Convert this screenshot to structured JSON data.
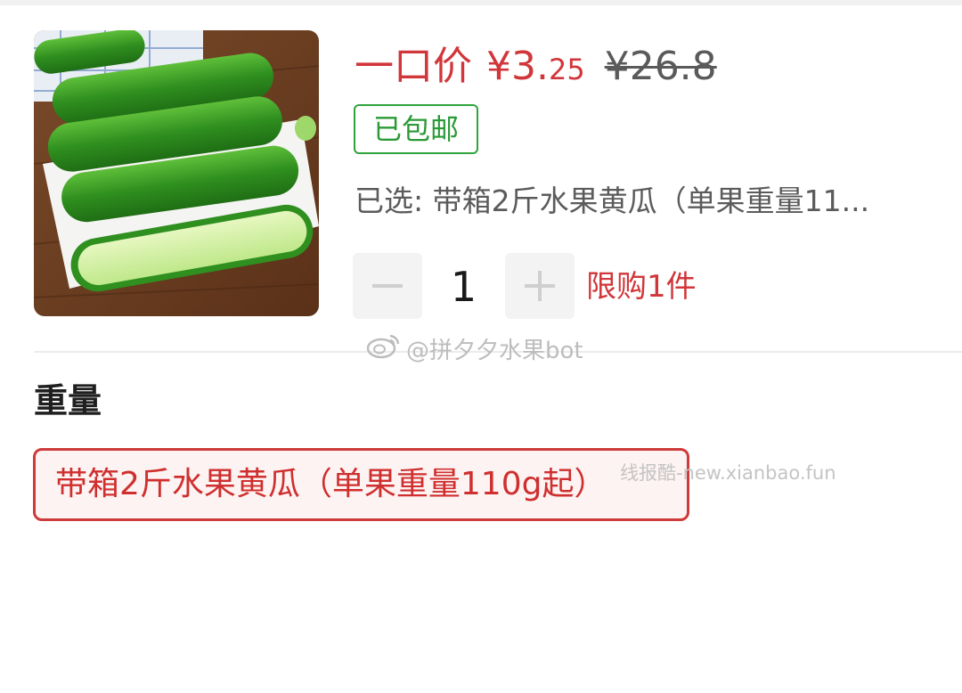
{
  "product": {
    "image_alt": "cucumber-photo",
    "price_label": "一口价",
    "currency_symbol": "¥",
    "price_integer": "3.",
    "price_decimal": "25",
    "original_price": "¥26.8",
    "shipping_badge": "已包邮",
    "selected_text": "已选: 带箱2斤水果黄瓜（单果重量11..."
  },
  "quantity": {
    "value": "1",
    "limit_text": "限购1件"
  },
  "spec": {
    "heading": "重量",
    "options": [
      {
        "label": "带箱2斤水果黄瓜（单果重量110g起）",
        "selected": true
      }
    ]
  },
  "watermarks": {
    "weibo": "@拼夕夕水果bot",
    "site": "线报酷-new.xianbao.fun"
  },
  "colors": {
    "accent_red": "#d1363a",
    "badge_green": "#2fa43c",
    "option_bg": "#fdf3f2"
  },
  "icons": [
    "minus-icon",
    "plus-icon",
    "weibo-icon"
  ]
}
